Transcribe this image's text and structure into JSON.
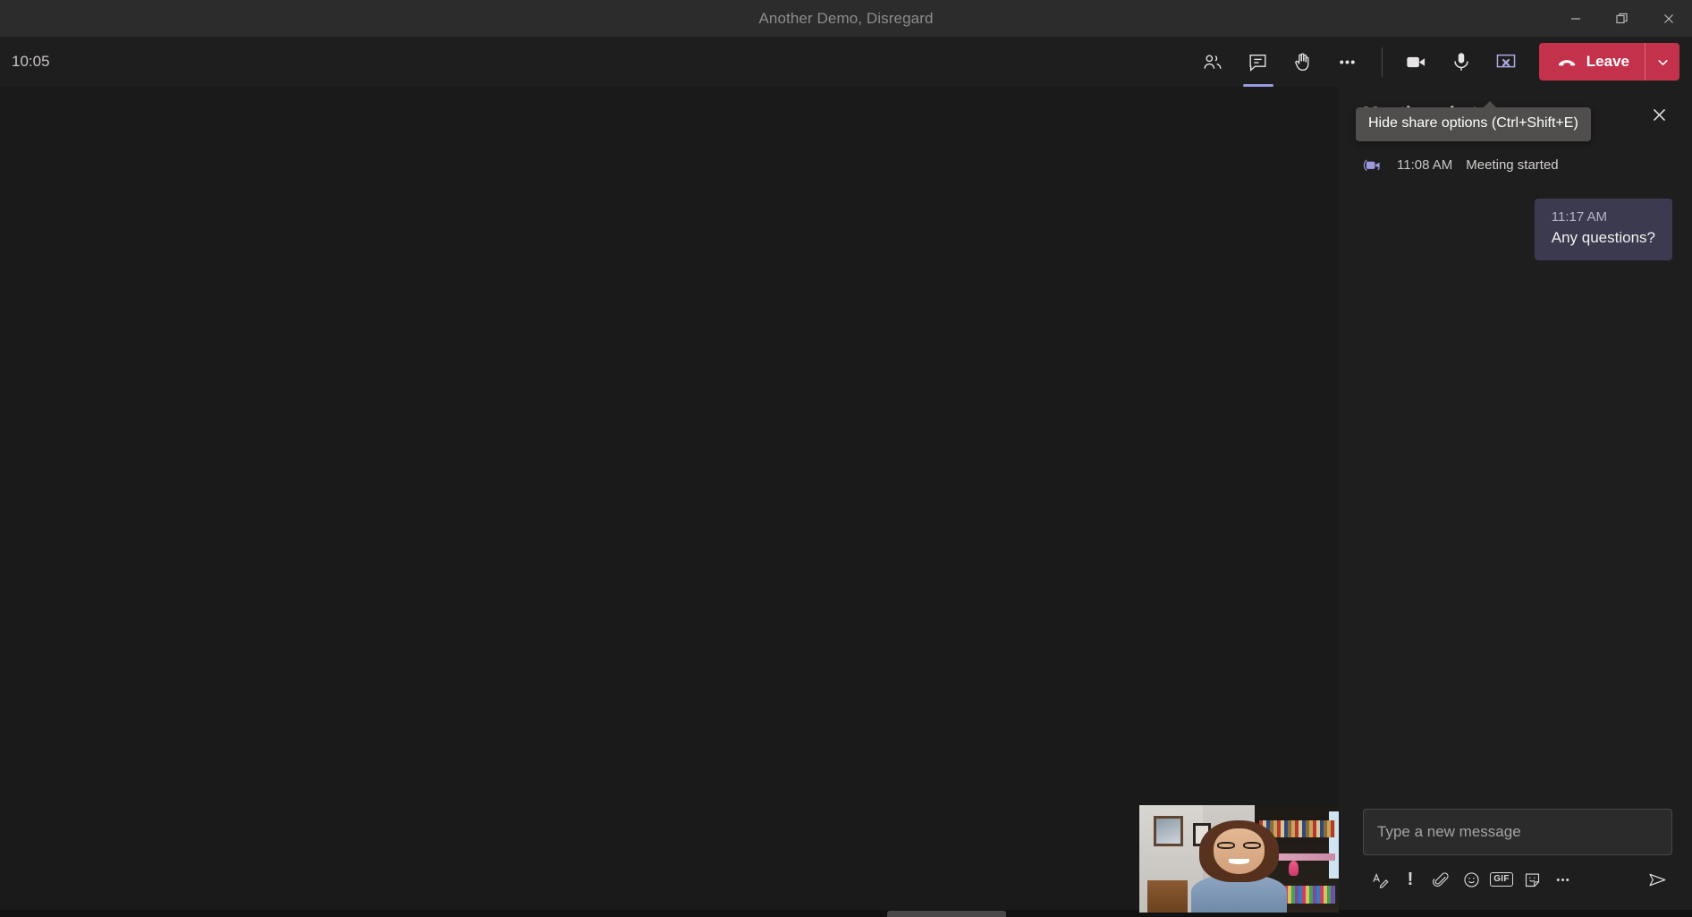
{
  "window": {
    "title": "Another Demo, Disregard",
    "controls": [
      {
        "name": "minimize",
        "label": "Minimize"
      },
      {
        "name": "restore",
        "label": "Restore"
      },
      {
        "name": "close",
        "label": "Close"
      }
    ]
  },
  "toolbar": {
    "timer": "10:05",
    "people_icon": "people-icon",
    "chat_icon": "chat-icon",
    "raise_hand_icon": "raise-hand-icon",
    "more_icon": "more-options-icon",
    "camera_icon": "camera-icon",
    "mic_icon": "microphone-icon",
    "share_icon": "stop-sharing-icon",
    "leave_label": "Leave",
    "leave_caret_icon": "chevron-down-icon",
    "leave_color": "#c4314b",
    "active_tab": "chat",
    "active_indicator_color": "#9a9ae0",
    "share_active_color": "#aaa9e0"
  },
  "tooltip": {
    "text": "Hide share options (Ctrl+Shift+E)",
    "background": "#4f4e4d"
  },
  "chat": {
    "title": "Meeting chat",
    "close_icon": "close-icon",
    "system_message": {
      "icon": "meeting-video-icon",
      "time": "11:08 AM",
      "text": "Meeting started"
    },
    "messages": [
      {
        "time": "11:17 AM",
        "text": "Any questions?",
        "outgoing": true,
        "read_receipt_icon": "seen-check-icon",
        "bubble_color": "#3b3a4e"
      }
    ]
  },
  "compose": {
    "placeholder": "Type a new message",
    "value": "",
    "actions": [
      {
        "name": "format-icon",
        "label": "Format"
      },
      {
        "name": "important-icon",
        "label": "!"
      },
      {
        "name": "attach-icon",
        "label": "Attach"
      },
      {
        "name": "emoji-icon",
        "label": "Emoji"
      },
      {
        "name": "gif-icon",
        "label": "GIF"
      },
      {
        "name": "sticker-icon",
        "label": "Sticker"
      },
      {
        "name": "more-icon",
        "label": "More options"
      }
    ],
    "send_icon": "send-icon"
  },
  "stage": {
    "background": "#1b1a1a",
    "selfview_present": true
  }
}
